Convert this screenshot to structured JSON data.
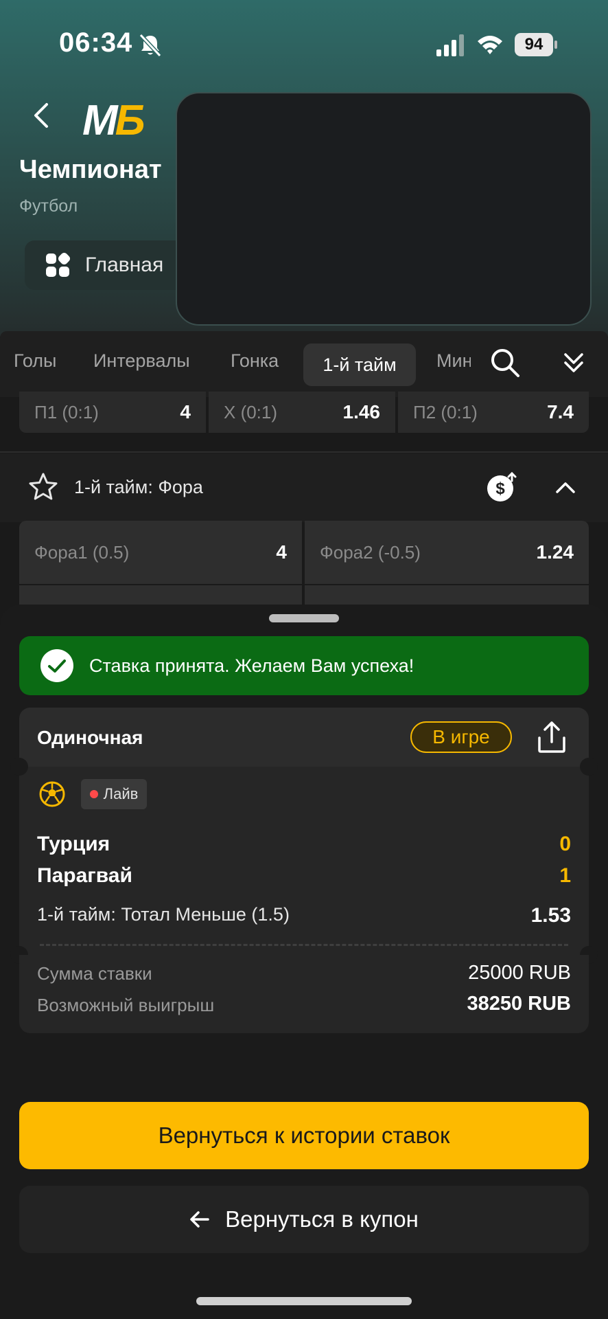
{
  "status_bar": {
    "time": "06:34",
    "battery": "94"
  },
  "header": {
    "logo_m": "М",
    "logo_b": "Б",
    "title": "Чемпионат",
    "subtitle": "Футбол",
    "main_chip_label": "Главная"
  },
  "tabs": [
    "Голы",
    "Интервалы",
    "Гонка",
    "1-й тайм",
    "Мин"
  ],
  "active_tab": "1-й тайм",
  "odds_row_top": [
    {
      "label": "П1 (0:1)",
      "value": "4"
    },
    {
      "label": "X (0:1)",
      "value": "1.46"
    },
    {
      "label": "П2 (0:1)",
      "value": "7.4"
    }
  ],
  "market": {
    "title": "1-й тайм: Фора",
    "odds": [
      {
        "label": "Фора1 (0.5)",
        "value": "4"
      },
      {
        "label": "Фора2 (-0.5)",
        "value": "1.24"
      }
    ]
  },
  "banner": {
    "text": "Ставка принята. Желаем Вам успеха!"
  },
  "bet": {
    "type": "Одиночная",
    "status": "В игре",
    "live_label": "Лайв",
    "team1": "Турция",
    "score1": "0",
    "team2": "Парагвай",
    "score2": "1",
    "outcome": "1-й тайм: Тотал Меньше (1.5)",
    "odd": "1.53",
    "stake_label": "Сумма ставки",
    "stake_value": "25000 RUB",
    "win_label": "Возможный выигрыш",
    "win_value": "38250 RUB"
  },
  "buttons": {
    "history": "Вернуться к истории ставок",
    "coupon": "Вернуться в купон"
  },
  "colors": {
    "accent": "#fdba00",
    "success": "#0b6b14",
    "live": "#ff4a4a"
  }
}
